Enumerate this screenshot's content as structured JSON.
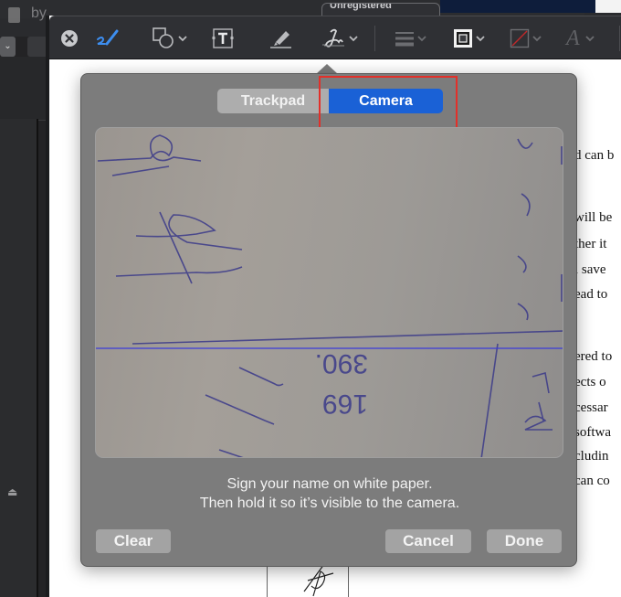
{
  "background_window": {
    "file_name": "by",
    "badge_label": "Unregistered"
  },
  "toolbar": {
    "items": [
      {
        "icon": "close-circle-icon"
      },
      {
        "icon": "sketch-icon",
        "active": true
      },
      {
        "icon": "shapes-icon",
        "has_menu": true
      },
      {
        "icon": "text-box-icon"
      },
      {
        "icon": "highlight-icon"
      },
      {
        "icon": "signature-icon",
        "has_menu": true
      },
      {
        "icon": "line-style-icon",
        "has_menu": true
      },
      {
        "icon": "border-color-icon",
        "has_menu": true
      },
      {
        "icon": "fill-color-icon",
        "has_menu": true
      },
      {
        "icon": "font-style-icon",
        "has_menu": true
      }
    ],
    "font_glyph": "A"
  },
  "document": {
    "lines": [
      "d can b",
      "will be",
      "ther it",
      "l save",
      "ead to",
      "ered to",
      "ects o",
      "cessar",
      "softwa",
      "cludin",
      "can co"
    ]
  },
  "signature_popover": {
    "tabs": [
      {
        "label": "Trackpad",
        "selected": false
      },
      {
        "label": "Camera",
        "selected": true
      }
    ],
    "instruction_line1": "Sign your name on white paper.",
    "instruction_line2": "Then hold it so it’s visible to the camera.",
    "buttons": {
      "clear": "Clear",
      "cancel": "Cancel",
      "done": "Done"
    },
    "camera_paper_text": [
      "390.",
      "169"
    ]
  },
  "colors": {
    "accent": "#1a61d6",
    "highlight_box": "#e2302a",
    "popover_bg": "#7c7c7c",
    "toolbar_bg": "#2f3034",
    "guide_line": "#3b3bd9"
  }
}
